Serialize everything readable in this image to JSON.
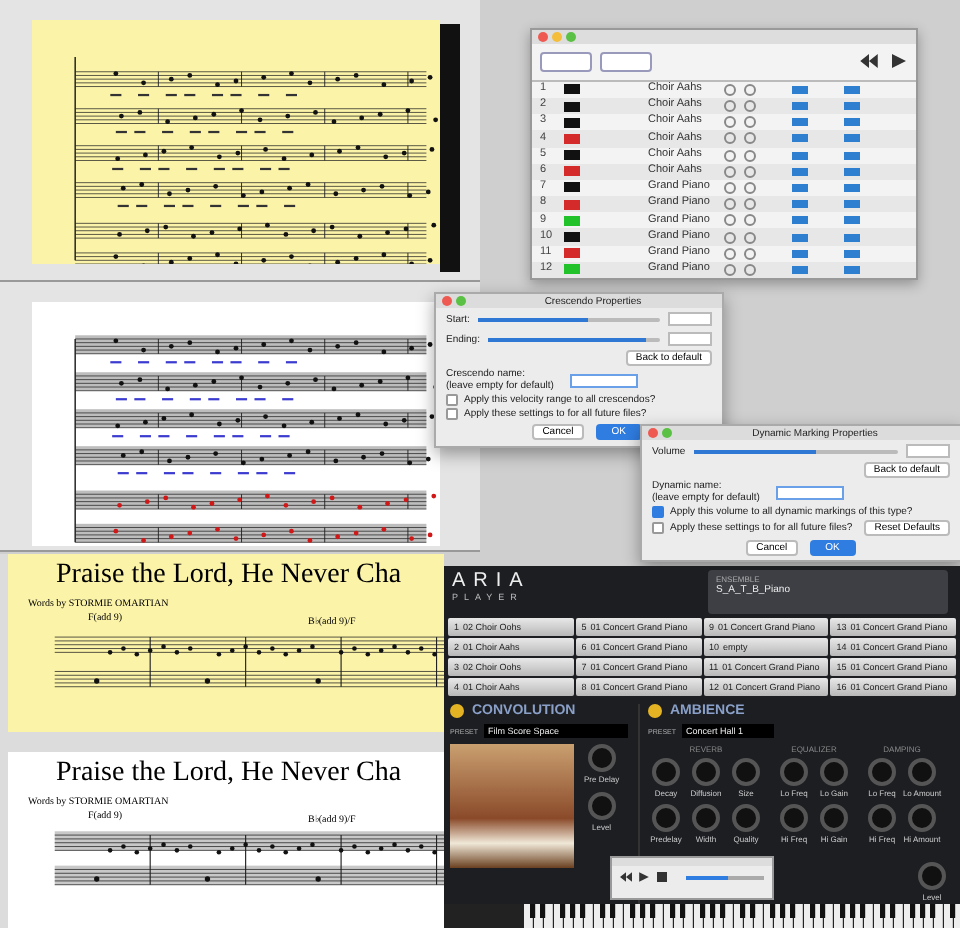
{
  "score_views": [
    {
      "kind": "yellow"
    },
    {
      "kind": "annotated"
    }
  ],
  "mixer": {
    "rows": [
      {
        "number": "1",
        "color": "#111111",
        "instrument": "Choir Aahs"
      },
      {
        "number": "2",
        "color": "#111111",
        "instrument": "Choir Aahs"
      },
      {
        "number": "3",
        "color": "#111111",
        "instrument": "Choir Aahs"
      },
      {
        "number": "4",
        "color": "#d42a2a",
        "instrument": "Choir Aahs"
      },
      {
        "number": "5",
        "color": "#111111",
        "instrument": "Choir Aahs"
      },
      {
        "number": "6",
        "color": "#d42a2a",
        "instrument": "Choir Aahs"
      },
      {
        "number": "7",
        "color": "#111111",
        "instrument": "Grand Piano"
      },
      {
        "number": "8",
        "color": "#d42a2a",
        "instrument": "Grand Piano"
      },
      {
        "number": "9",
        "color": "#22c22a",
        "instrument": "Grand Piano"
      },
      {
        "number": "10",
        "color": "#111111",
        "instrument": "Grand Piano"
      },
      {
        "number": "11",
        "color": "#d42a2a",
        "instrument": "Grand Piano"
      },
      {
        "number": "12",
        "color": "#22c22a",
        "instrument": "Grand Piano"
      }
    ]
  },
  "crescendo_dialog": {
    "title": "Crescendo Properties",
    "sliders": [
      {
        "label": "Start:",
        "level": 0.6
      },
      {
        "label": "Ending:",
        "level": 0.92
      }
    ],
    "back_button": "Back to default",
    "name_label": "Crescendo name:",
    "name_hint": "(leave empty for default)",
    "options": [
      {
        "label": "Apply this velocity range to all crescendos?",
        "checked": false
      },
      {
        "label": "Apply these settings to for all future files?",
        "checked": false
      }
    ],
    "cancel": "Cancel",
    "ok": "OK"
  },
  "dynamic_dialog": {
    "title": "Dynamic Marking Properties",
    "volume": {
      "label": "Volume",
      "level": 0.6
    },
    "back_button": "Back to default",
    "name_label": "Dynamic name:",
    "name_hint": "(leave empty for default)",
    "options": [
      {
        "label": "Apply this volume to all dynamic markings of this type?",
        "checked": true
      },
      {
        "label": "Apply these settings to for all future files?",
        "checked": false
      }
    ],
    "reset_button": "Reset Defaults",
    "cancel": "Cancel",
    "ok": "OK"
  },
  "lead_sheets": [
    {
      "title": "Praise the Lord, He Never Cha",
      "credit": "Words by STORMIE OMARTIAN",
      "chords": [
        "F(add 9)",
        "B♭(add 9)/F"
      ],
      "highlighted": true
    },
    {
      "title": "Praise the Lord, He Never Cha",
      "credit": "Words by STORMIE OMARTIAN",
      "chords": [
        "F(add 9)",
        "B♭(add 9)/F"
      ],
      "highlighted": false
    }
  ],
  "aria": {
    "logo": "ARIA",
    "logo_sub": "PLAYER",
    "ensemble_label": "ENSEMBLE",
    "ensemble": "S_A_T_B_Piano",
    "slots": [
      {
        "num": "1",
        "name": "02 Choir Oohs"
      },
      {
        "num": "5",
        "name": "01 Concert Grand Piano"
      },
      {
        "num": "9",
        "name": "01 Concert Grand Piano"
      },
      {
        "num": "13",
        "name": "01 Concert Grand Piano"
      },
      {
        "num": "2",
        "name": "01 Choir Aahs"
      },
      {
        "num": "6",
        "name": "01 Concert Grand Piano"
      },
      {
        "num": "10",
        "name": "empty"
      },
      {
        "num": "14",
        "name": "01 Concert Grand Piano"
      },
      {
        "num": "3",
        "name": "02 Choir Oohs"
      },
      {
        "num": "7",
        "name": "01 Concert Grand Piano"
      },
      {
        "num": "11",
        "name": "01 Concert Grand Piano"
      },
      {
        "num": "15",
        "name": "01 Concert Grand Piano"
      },
      {
        "num": "4",
        "name": "01 Choir Aahs"
      },
      {
        "num": "8",
        "name": "01 Concert Grand Piano"
      },
      {
        "num": "12",
        "name": "01 Concert Grand Piano"
      },
      {
        "num": "16",
        "name": "01 Concert Grand Piano"
      }
    ],
    "convolution": {
      "title": "CONVOLUTION",
      "on": true,
      "preset_label": "PRESET",
      "preset": "Film Score Space",
      "knobs": [
        "Pre Delay",
        "Level"
      ]
    },
    "ambience": {
      "title": "AMBIENCE",
      "on": true,
      "preset_label": "PRESET",
      "preset": "Concert Hall 1",
      "sections": [
        {
          "title": "REVERB",
          "knobs": [
            "Decay",
            "Diffusion",
            "Size",
            "Predelay",
            "Width",
            "Quality"
          ]
        },
        {
          "title": "EQUALIZER",
          "knobs": [
            "Lo Freq",
            "Lo Gain",
            "Hi Freq",
            "Hi Gain"
          ]
        },
        {
          "title": "DAMPING",
          "knobs": [
            "Lo Freq",
            "Lo Amount",
            "Hi Freq",
            "Hi Amount"
          ]
        }
      ],
      "level_knob": "Level"
    },
    "transport": {
      "level": 0.55
    }
  }
}
